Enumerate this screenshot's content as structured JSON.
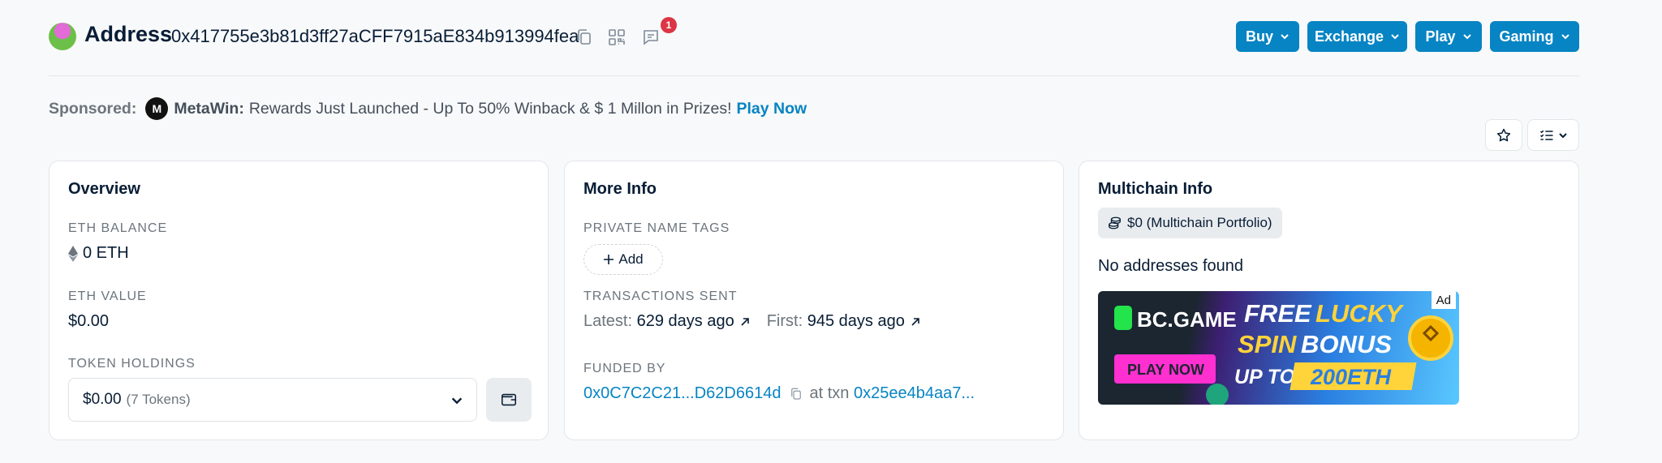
{
  "header": {
    "title": "Address",
    "address": "0x417755e3b81d3ff27aCFF7915aE834b913994fea",
    "icons": [
      "copy-icon",
      "qr-code-icon",
      "comment-icon"
    ],
    "notification_count": "1",
    "menus": [
      {
        "label": "Buy"
      },
      {
        "label": "Exchange"
      },
      {
        "label": "Play"
      },
      {
        "label": "Gaming"
      }
    ]
  },
  "sponsor": {
    "label": "Sponsored:",
    "logo_letter": "M",
    "brand": "MetaWin:",
    "text": "Rewards Just Launched - Up To 50% Winback & $ 1 Millon in Prizes!",
    "link": "Play Now"
  },
  "overview": {
    "title": "Overview",
    "eth_balance_label": "ETH BALANCE",
    "eth_balance_value": "0 ETH",
    "eth_value_label": "ETH VALUE",
    "eth_value_value": "$0.00",
    "token_holdings_label": "TOKEN HOLDINGS",
    "token_holdings_value": "$0.00",
    "token_count": "(7 Tokens)"
  },
  "more_info": {
    "title": "More Info",
    "private_tags_label": "PRIVATE NAME TAGS",
    "add_label": "Add",
    "tx_sent_label": "TRANSACTIONS SENT",
    "latest_label": "Latest:",
    "latest_value": "629 days ago",
    "first_label": "First:",
    "first_value": "945 days ago",
    "funded_by_label": "FUNDED BY",
    "funded_by_address": "0x0C7C2C21...D62D6614d",
    "at_txn_label": "at txn",
    "txn_hash": "0x25ee4b4aa7..."
  },
  "multichain": {
    "title": "Multichain Info",
    "portfolio_label": "$0 (Multichain Portfolio)",
    "no_addresses": "No addresses found",
    "ad_tag": "Ad",
    "ad": {
      "brand": "BC.GAME",
      "cta": "PLAY NOW",
      "line1_a": "FREE",
      "line1_b": "LUCKY",
      "line2_a": "SPIN",
      "line2_b": "BONUS",
      "line3_a": "UP TO",
      "line3_b": "200ETH"
    }
  },
  "colors": {
    "accent": "#0784c3",
    "text": "#081d35",
    "muted": "#6c757d",
    "badge": "#dc3545"
  }
}
